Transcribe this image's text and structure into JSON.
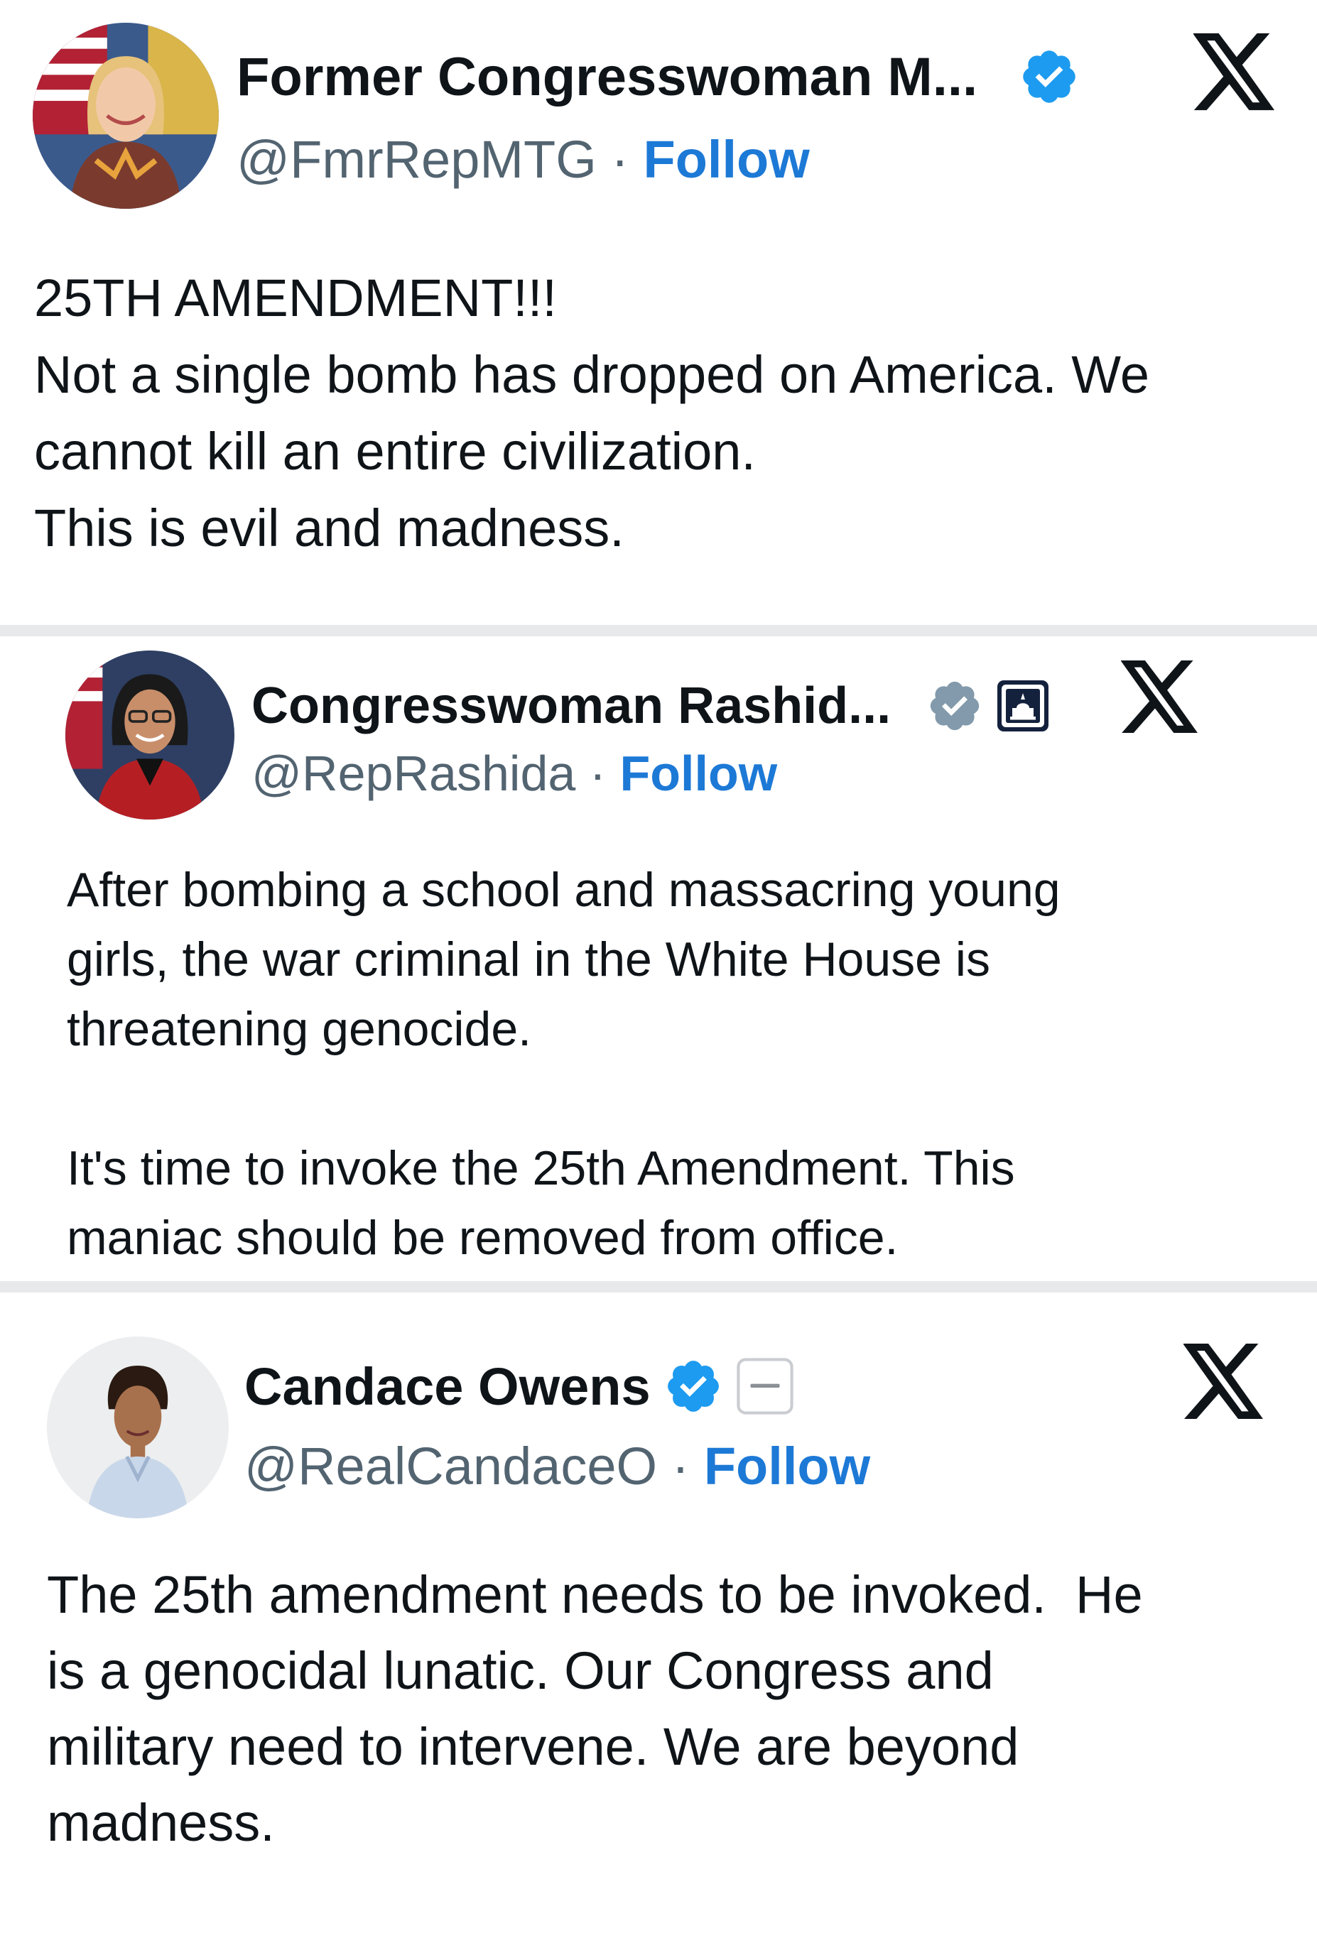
{
  "colors": {
    "verified_blue": "#1d9bf0",
    "gov_gray": "#829aab",
    "follow_blue": "#1d79d6",
    "divider": "#e8e9ea"
  },
  "posts": [
    {
      "name": "Former Congresswoman M...",
      "handle": "@FmrRepMTG",
      "separator": "·",
      "follow": "Follow",
      "badge_icon": "verified-blue-icon",
      "lines": [
        "25TH AMENDMENT!!!",
        "Not a single bomb has dropped on America. We",
        "cannot kill an entire civilization.",
        "This is evil and madness."
      ]
    },
    {
      "name": "Congresswoman Rashid...",
      "handle": "@RepRashida",
      "separator": "·",
      "follow": "Follow",
      "badge_icon": "verified-gray-icon",
      "affiliation_icon": "capitol-icon",
      "paragraphs": [
        [
          "After bombing a school and massacring young",
          "girls, the war criminal in the White House is",
          "threatening genocide."
        ],
        [
          "It's time to invoke the 25th Amendment. This",
          "maniac should be removed from office."
        ]
      ]
    },
    {
      "name": "Candace Owens",
      "handle": "@RealCandaceO",
      "separator": "·",
      "follow": "Follow",
      "badge_icon": "verified-blue-icon",
      "affiliation_icon": "business-badge-icon",
      "lines": [
        "The 25th amendment needs to be invoked.  He",
        "is a genocidal lunatic. Our Congress and",
        "military need to intervene. We are beyond",
        "madness."
      ]
    }
  ]
}
